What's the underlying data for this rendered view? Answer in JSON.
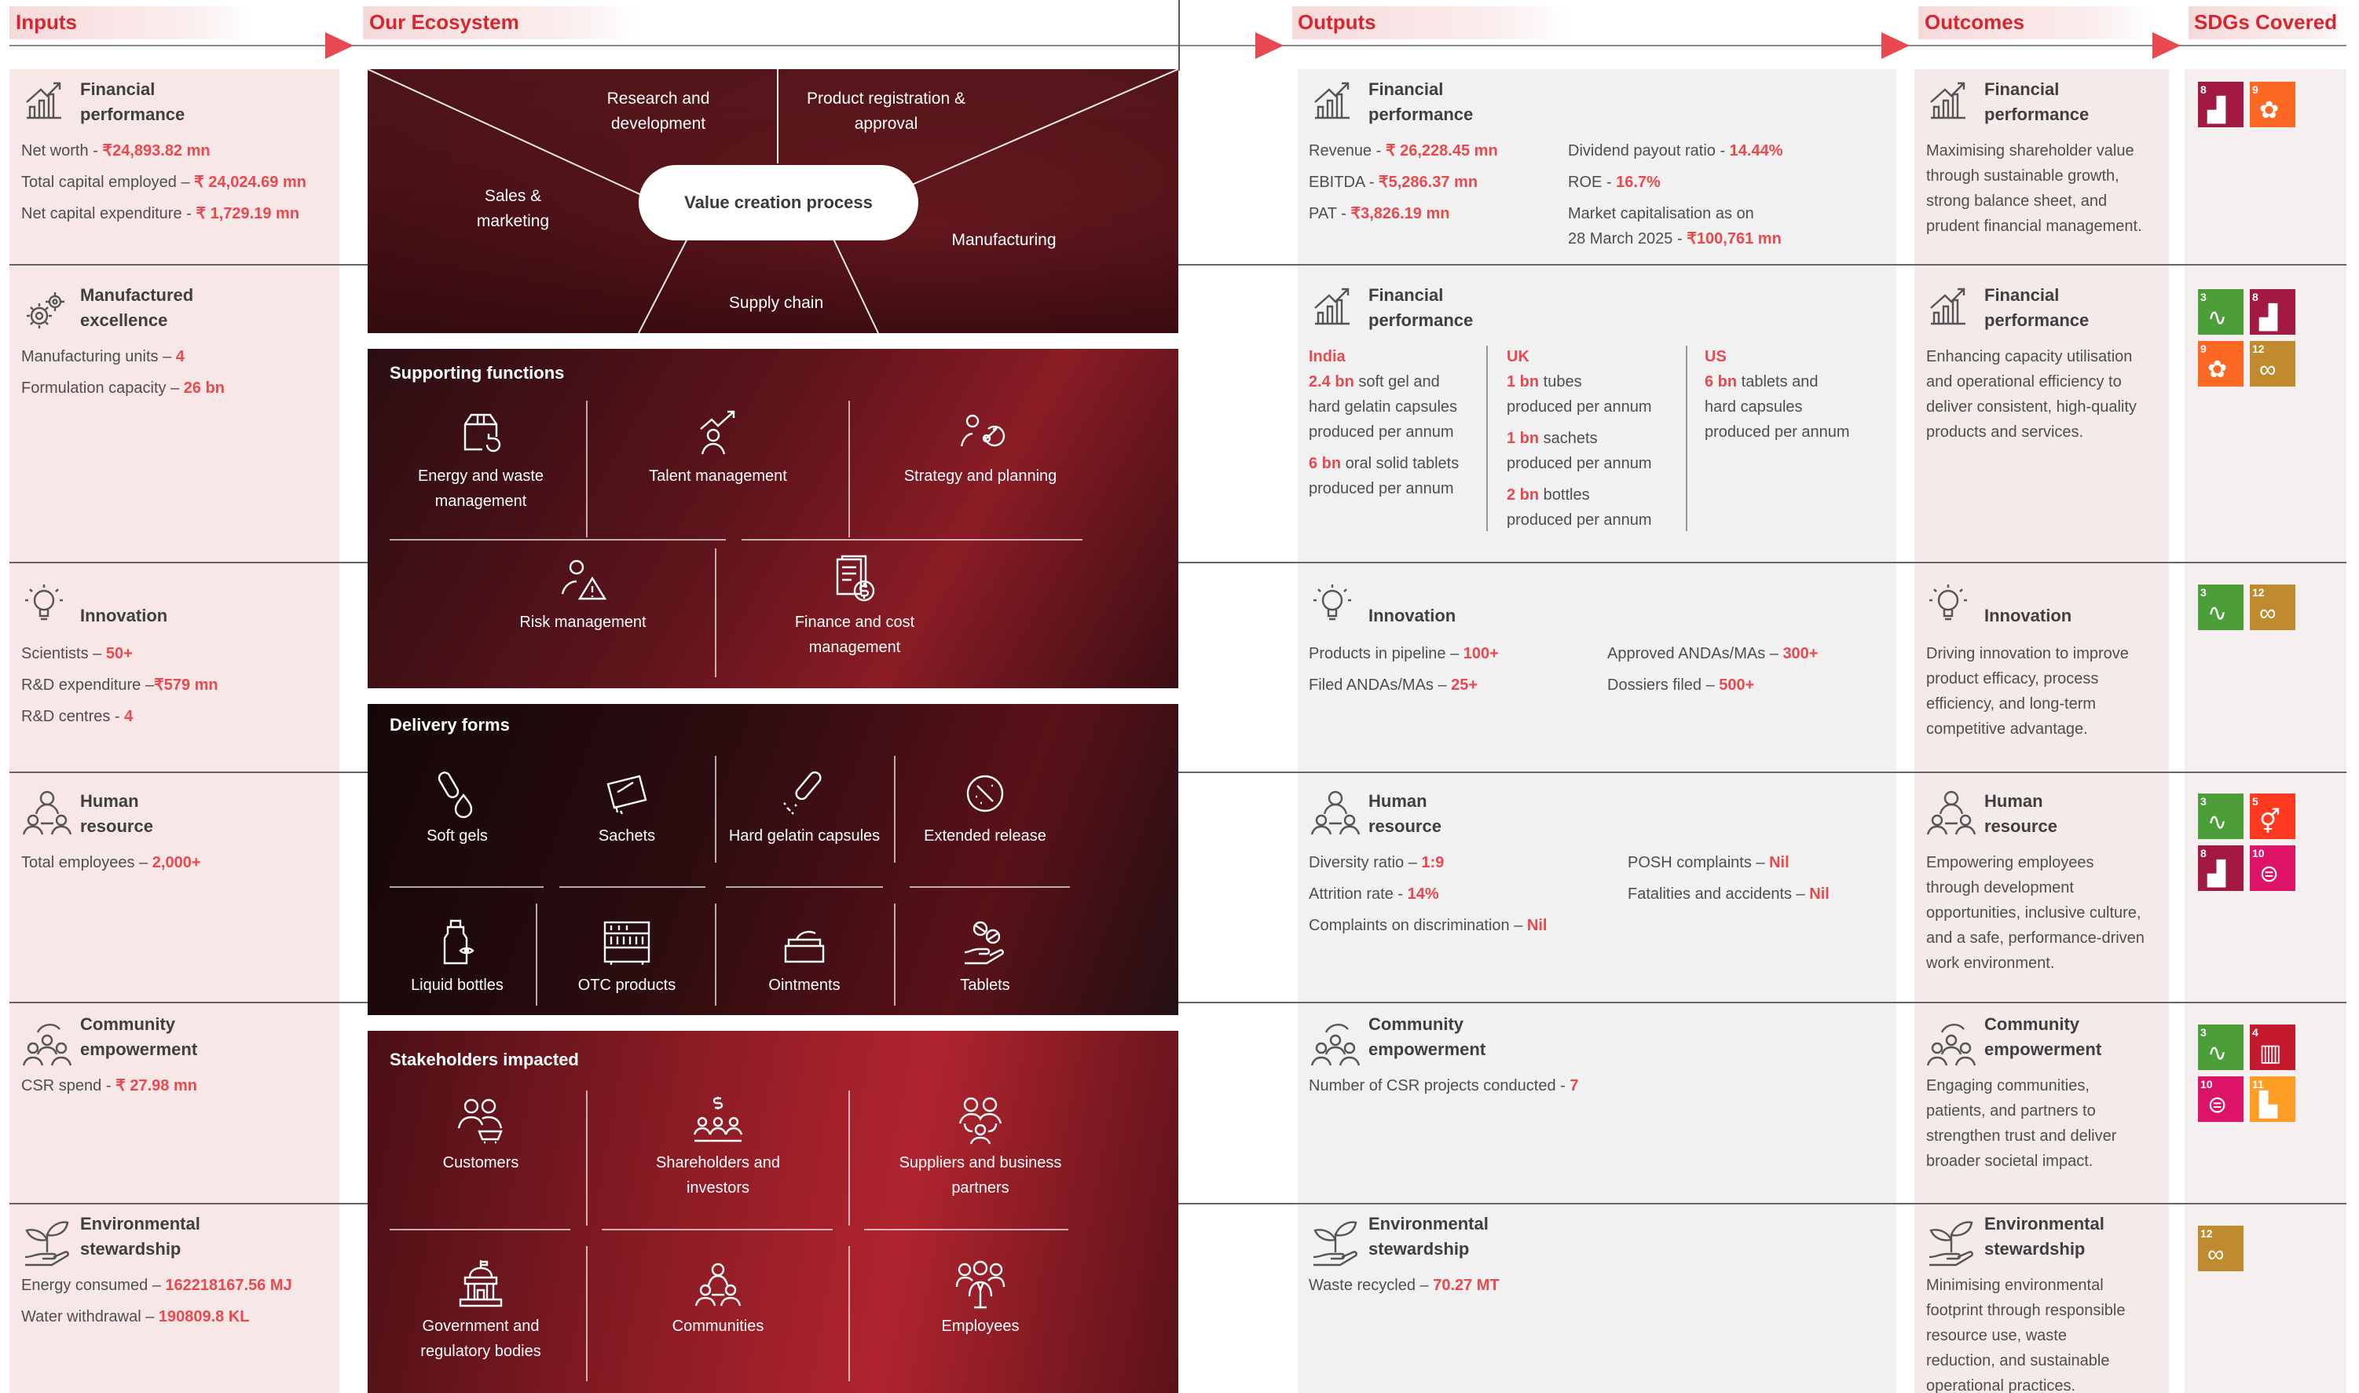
{
  "headers": {
    "inputs": "Inputs",
    "ecosystem": "Our Ecosystem",
    "outputs": "Outputs",
    "outcomes": "Outcomes",
    "sdgs": "SDGs Covered"
  },
  "inputs": {
    "financial": {
      "title1": "Financial",
      "title2": "performance",
      "l1": "Net worth - ",
      "v1": "₹24,893.82  mn",
      "l2": "Total capital employed – ",
      "v2": "₹ 24,024.69 mn",
      "l3": "Net capital expenditure - ",
      "v3": "₹ 1,729.19 mn"
    },
    "manufactured": {
      "title1": "Manufactured",
      "title2": "excellence",
      "l1": "Manufacturing units – ",
      "v1": "4",
      "l2": "Formulation capacity – ",
      "v2": "26 bn"
    },
    "innovation": {
      "title1": "Innovation",
      "l1": "Scientists – ",
      "v1": "50+",
      "l2": "R&D expenditure –",
      "v2": "₹579 mn",
      "l3": "R&D centres - ",
      "v3": "4"
    },
    "human": {
      "title1": "Human",
      "title2": "resource",
      "l1": "Total employees – ",
      "v1": "2,000+"
    },
    "community": {
      "title1": "Community",
      "title2": "empowerment",
      "l1": "CSR spend - ",
      "v1": "₹ 27.98 mn"
    },
    "environmental": {
      "title1": "Environmental",
      "title2": "stewardship",
      "l1": "Energy consumed – ",
      "v1": "162218167.56 MJ",
      "l2": "Water withdrawal – ",
      "v2": "190809.8 KL"
    }
  },
  "ecosystem": {
    "research": "Research and development",
    "product_reg": "Product registration & approval",
    "sales": "Sales & marketing",
    "value_creation": "Value creation process",
    "manufacturing": "Manufacturing",
    "supply_chain": "Supply chain",
    "supporting": {
      "title": "Supporting functions",
      "items": [
        "Energy and waste management",
        "Talent management",
        "Strategy and planning",
        "Risk management",
        "Finance and cost management"
      ]
    },
    "delivery": {
      "title": "Delivery forms",
      "items": [
        "Soft gels",
        "Sachets",
        "Hard gelatin capsules",
        "Extended release",
        "Liquid bottles",
        "OTC products",
        "Ointments",
        "Tablets"
      ]
    },
    "stakeholders": {
      "title": "Stakeholders impacted",
      "items": [
        "Customers",
        "Shareholders and investors",
        "Suppliers and business partners",
        "Government and regulatory bodies",
        "Communities",
        "Employees"
      ]
    }
  },
  "outputs": {
    "financial": {
      "title1": "Financial",
      "title2": "performance",
      "l1": "Revenue - ",
      "v1": "₹ 26,228.45 mn",
      "l2": "EBITDA - ",
      "v2": "₹5,286.37 mn",
      "l3": "PAT - ",
      "v3": "₹3,826.19 mn",
      "l4": "Dividend payout ratio - ",
      "v4": "14.44%",
      "l5": "ROE - ",
      "v5": "16.7%",
      "l6": "Market capitalisation as on",
      "l7": "28 March 2025 - ",
      "v7": "₹100,761 mn"
    },
    "manufactured": {
      "title1": "Financial",
      "title2": "performance",
      "india_h": "India",
      "india_1v": "2.4 bn",
      "india_1": " soft gel and",
      "india_2": "hard gelatin capsules",
      "india_3": "produced per annum",
      "india_4v": "6 bn",
      "india_4": " oral solid tablets",
      "india_5": "produced per annum",
      "uk_h": "UK",
      "uk_1v": "1 bn",
      "uk_1": " tubes",
      "uk_2": "produced per annum",
      "uk_3v": "1 bn",
      "uk_3": " sachets",
      "uk_4": "produced per annum",
      "uk_5v": "2 bn",
      "uk_5": " bottles",
      "uk_6": "produced per annum",
      "us_h": "US",
      "us_1v": "6 bn",
      "us_1": " tablets and",
      "us_2": "hard capsules",
      "us_3": "produced per annum"
    },
    "innovation": {
      "title1": "Innovation",
      "l1": "Products in pipeline – ",
      "v1": "100+",
      "l2": "Filed ANDAs/MAs – ",
      "v2": "25+",
      "l3": "Approved ANDAs/MAs  – ",
      "v3": "300+",
      "l4": "Dossiers filed – ",
      "v4": "500+"
    },
    "human": {
      "title1": "Human",
      "title2": "resource",
      "l1": "Diversity ratio – ",
      "v1": "1:9",
      "l2": "Attrition rate - ",
      "v2": "14%",
      "l3": "Complaints on discrimination – ",
      "v3": "Nil",
      "l4": "POSH complaints – ",
      "v4": "Nil",
      "l5": "Fatalities and accidents – ",
      "v5": "Nil"
    },
    "community": {
      "title1": "Community",
      "title2": "empowerment",
      "l1": "Number of CSR projects conducted - ",
      "v1": "7"
    },
    "environmental": {
      "title1": "Environmental",
      "title2": "stewardship",
      "l1": "Waste recycled – ",
      "v1": "70.27 MT"
    }
  },
  "outcomes": {
    "financial": {
      "title1": "Financial",
      "title2": "performance",
      "lines": [
        "Maximising shareholder value",
        "through sustainable growth,",
        "strong balance sheet, and",
        "prudent financial management."
      ]
    },
    "manufactured": {
      "title1": "Financial",
      "title2": "performance",
      "lines": [
        "Enhancing capacity utilisation",
        "and operational efficiency to",
        "deliver consistent, high-quality",
        "products and services."
      ]
    },
    "innovation": {
      "title1": "Innovation",
      "lines": [
        "Driving innovation to improve",
        "product efficacy, process",
        "efficiency, and long-term",
        "competitive advantage."
      ]
    },
    "human": {
      "title1": "Human",
      "title2": "resource",
      "lines": [
        "Empowering employees",
        "through development",
        "opportunities, inclusive culture,",
        "and a safe, performance-driven",
        "work environment."
      ]
    },
    "community": {
      "title1": "Community",
      "title2": "empowerment",
      "lines": [
        "Engaging communities,",
        "patients, and partners to",
        "strengthen trust and deliver",
        "broader societal impact."
      ]
    },
    "environmental": {
      "title1": "Environmental",
      "title2": "stewardship",
      "lines": [
        "Minimising environmental",
        "footprint through responsible",
        "resource use, waste",
        "reduction, and sustainable",
        "operational practices."
      ]
    }
  },
  "sdgs": {
    "row1": [
      {
        "n": "8",
        "label": "DECENT WORK AND ECONOMIC GROWTH",
        "color": "#a21942",
        "g": "▟"
      },
      {
        "n": "9",
        "label": "INDUSTRY, INNOVATION AND INFRASTRUCTURE",
        "color": "#fd6925",
        "g": "✿"
      }
    ],
    "row2": [
      {
        "n": "3",
        "label": "GOOD HEALTH AND WELL-BEING",
        "color": "#4c9f38",
        "g": "∿"
      },
      {
        "n": "8",
        "label": "DECENT WORK AND ECONOMIC GROWTH",
        "color": "#a21942",
        "g": "▟"
      },
      {
        "n": "9",
        "label": "INDUSTRY, INNOVATION AND INFRASTRUCTURE",
        "color": "#fd6925",
        "g": "✿"
      },
      {
        "n": "12",
        "label": "RESPONSIBLE CONSUMPTION AND PRODUCTION",
        "color": "#bf8b2e",
        "g": "∞"
      }
    ],
    "row3": [
      {
        "n": "3",
        "label": "GOOD HEALTH AND WELL-BEING",
        "color": "#4c9f38",
        "g": "∿"
      },
      {
        "n": "12",
        "label": "RESPONSIBLE CONSUMPTION AND PRODUCTION",
        "color": "#bf8b2e",
        "g": "∞"
      }
    ],
    "row4": [
      {
        "n": "3",
        "label": "GOOD HEALTH AND WELL-BEING",
        "color": "#4c9f38",
        "g": "∿"
      },
      {
        "n": "5",
        "label": "GENDER EQUALITY",
        "color": "#ff3a21",
        "g": "⚥"
      },
      {
        "n": "8",
        "label": "DECENT WORK AND ECONOMIC GROWTH",
        "color": "#a21942",
        "g": "▟"
      },
      {
        "n": "10",
        "label": "REDUCED INEQUALITIES",
        "color": "#dd1367",
        "g": "⊜"
      }
    ],
    "row5": [
      {
        "n": "3",
        "label": "GOOD HEALTH AND WELL-BEING",
        "color": "#4c9f38",
        "g": "∿"
      },
      {
        "n": "4",
        "label": "QUALITY EDUCATION",
        "color": "#c5192d",
        "g": "▥"
      },
      {
        "n": "10",
        "label": "REDUCED INEQUALITIES",
        "color": "#dd1367",
        "g": "⊜"
      },
      {
        "n": "11",
        "label": "SUSTAINABLE CITIES AND COMMUNITIES",
        "color": "#fd9d24",
        "g": "▙"
      }
    ],
    "row6": [
      {
        "n": "12",
        "label": "RESPONSIBLE CONSUMPTION AND PRODUCTION",
        "color": "#bf8b2e",
        "g": "∞"
      }
    ]
  },
  "colors": {
    "accent": "#d9262e",
    "value_red": "#e8494f",
    "panel_dark": "#1a0c0e",
    "panel_red": "#8c1b22"
  }
}
